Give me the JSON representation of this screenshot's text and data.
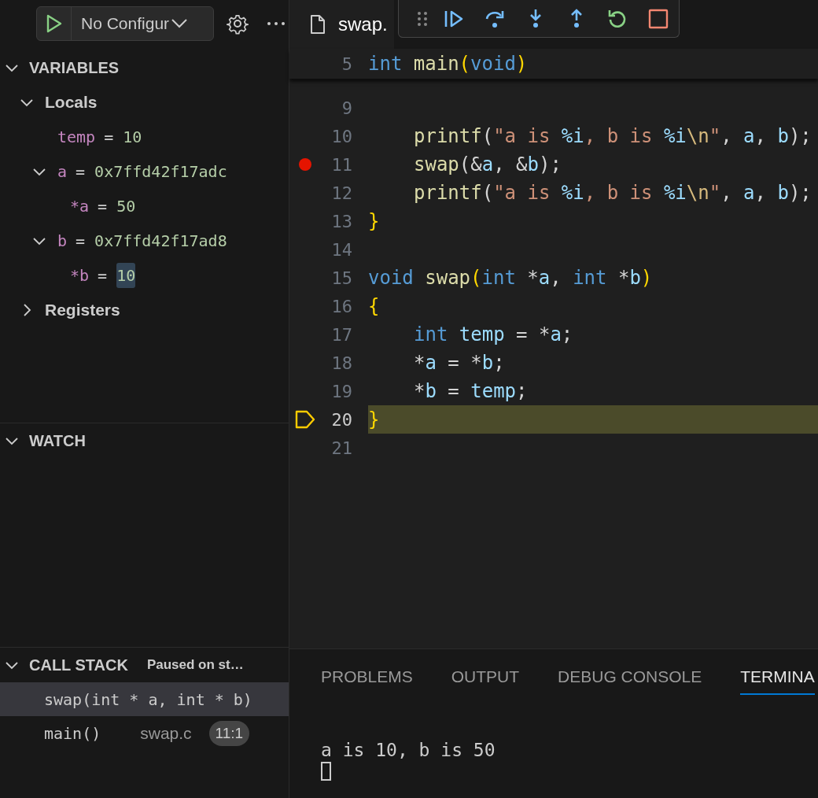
{
  "run_config": {
    "label": "No Configur"
  },
  "variables": {
    "title": "VARIABLES",
    "expanded": true,
    "items": [
      {
        "kind": "scope",
        "label": "Locals",
        "expanded": true,
        "children": [
          {
            "kind": "variable",
            "name": "temp",
            "operator": "=",
            "value": "10",
            "changed": false
          },
          {
            "kind": "variable",
            "name": "a",
            "operator": "=",
            "value": "0x7ffd42f17adc",
            "changed": false,
            "expanded": true,
            "children": [
              {
                "kind": "variable",
                "name": "*a",
                "operator": "=",
                "value": "50",
                "changed": false
              }
            ]
          },
          {
            "kind": "variable",
            "name": "b",
            "operator": "=",
            "value": "0x7ffd42f17ad8",
            "changed": false,
            "expanded": true,
            "children": [
              {
                "kind": "variable",
                "name": "*b",
                "operator": "=",
                "value": "10",
                "changed": true
              }
            ]
          }
        ]
      },
      {
        "kind": "scope",
        "label": "Registers",
        "expanded": false
      }
    ]
  },
  "watch": {
    "title": "WATCH",
    "expanded": true
  },
  "call_stack": {
    "title": "CALL STACK",
    "expanded": true,
    "status": "Paused on st…",
    "frames": [
      {
        "label": "swap(int * a, int * b)",
        "selected": true
      },
      {
        "label": "main()",
        "file": "swap.c",
        "position": "11:1",
        "selected": false
      }
    ]
  },
  "editor_tab": {
    "label": "swap."
  },
  "debug_toolbar": {
    "buttons": [
      {
        "kind": "continue"
      },
      {
        "kind": "step_over"
      },
      {
        "kind": "step_into"
      },
      {
        "kind": "step_out"
      },
      {
        "kind": "restart"
      },
      {
        "kind": "stop"
      }
    ]
  },
  "sticky_line": {
    "number": "5",
    "indented": false,
    "tokens": [
      {
        "text": "int",
        "kind": "keyword"
      },
      {
        "text": " main",
        "kind": "function"
      },
      {
        "text": "(",
        "kind": "bracket"
      },
      {
        "text": "void",
        "kind": "keyword"
      },
      {
        "text": ")",
        "kind": "bracket"
      }
    ]
  },
  "code_lines": [
    {
      "number": "9",
      "breakpoint": false,
      "current": false
    },
    {
      "number": "10",
      "breakpoint": false,
      "current": false,
      "indented": true,
      "tokens": [
        {
          "text": "printf",
          "kind": "function"
        },
        {
          "text": "(",
          "kind": "plain"
        },
        {
          "text": "\"a is ",
          "kind": "string"
        },
        {
          "text": "%i",
          "kind": "format"
        },
        {
          "text": ", b is ",
          "kind": "string"
        },
        {
          "text": "%i",
          "kind": "format"
        },
        {
          "text": "\\n",
          "kind": "escape"
        },
        {
          "text": "\"",
          "kind": "string"
        },
        {
          "text": ", ",
          "kind": "plain"
        },
        {
          "text": "a",
          "kind": "variable"
        },
        {
          "text": ", ",
          "kind": "plain"
        },
        {
          "text": "b",
          "kind": "variable"
        },
        {
          "text": ");",
          "kind": "plain"
        }
      ]
    },
    {
      "number": "11",
      "breakpoint": true,
      "current": false,
      "indented": true,
      "tokens": [
        {
          "text": "swap",
          "kind": "function"
        },
        {
          "text": "(&",
          "kind": "plain"
        },
        {
          "text": "a",
          "kind": "variable"
        },
        {
          "text": ", &",
          "kind": "plain"
        },
        {
          "text": "b",
          "kind": "variable"
        },
        {
          "text": ");",
          "kind": "plain"
        }
      ]
    },
    {
      "number": "12",
      "breakpoint": false,
      "current": false,
      "indented": true,
      "tokens": [
        {
          "text": "printf",
          "kind": "function"
        },
        {
          "text": "(",
          "kind": "plain"
        },
        {
          "text": "\"a is ",
          "kind": "string"
        },
        {
          "text": "%i",
          "kind": "format"
        },
        {
          "text": ", b is ",
          "kind": "string"
        },
        {
          "text": "%i",
          "kind": "format"
        },
        {
          "text": "\\n",
          "kind": "escape"
        },
        {
          "text": "\"",
          "kind": "string"
        },
        {
          "text": ", ",
          "kind": "plain"
        },
        {
          "text": "a",
          "kind": "variable"
        },
        {
          "text": ", ",
          "kind": "plain"
        },
        {
          "text": "b",
          "kind": "variable"
        },
        {
          "text": ");",
          "kind": "plain"
        }
      ]
    },
    {
      "number": "13",
      "breakpoint": false,
      "current": false,
      "indented": false,
      "tokens": [
        {
          "text": "}",
          "kind": "bracket"
        }
      ]
    },
    {
      "number": "14",
      "breakpoint": false,
      "current": false
    },
    {
      "number": "15",
      "breakpoint": false,
      "current": false,
      "indented": false,
      "tokens": [
        {
          "text": "void",
          "kind": "keyword"
        },
        {
          "text": " swap",
          "kind": "function"
        },
        {
          "text": "(",
          "kind": "bracket"
        },
        {
          "text": "int",
          "kind": "keyword"
        },
        {
          "text": " *",
          "kind": "plain"
        },
        {
          "text": "a",
          "kind": "variable"
        },
        {
          "text": ", ",
          "kind": "plain"
        },
        {
          "text": "int",
          "kind": "keyword"
        },
        {
          "text": " *",
          "kind": "plain"
        },
        {
          "text": "b",
          "kind": "variable"
        },
        {
          "text": ")",
          "kind": "bracket"
        }
      ]
    },
    {
      "number": "16",
      "breakpoint": false,
      "current": false,
      "indented": false,
      "tokens": [
        {
          "text": "{",
          "kind": "bracket"
        }
      ]
    },
    {
      "number": "17",
      "breakpoint": false,
      "current": false,
      "indented": true,
      "tokens": [
        {
          "text": "int",
          "kind": "keyword"
        },
        {
          "text": " temp",
          "kind": "variable"
        },
        {
          "text": " = *",
          "kind": "plain"
        },
        {
          "text": "a",
          "kind": "variable"
        },
        {
          "text": ";",
          "kind": "plain"
        }
      ]
    },
    {
      "number": "18",
      "breakpoint": false,
      "current": false,
      "indented": true,
      "tokens": [
        {
          "text": "*",
          "kind": "plain"
        },
        {
          "text": "a",
          "kind": "variable"
        },
        {
          "text": " = *",
          "kind": "plain"
        },
        {
          "text": "b",
          "kind": "variable"
        },
        {
          "text": ";",
          "kind": "plain"
        }
      ]
    },
    {
      "number": "19",
      "breakpoint": false,
      "current": false,
      "indented": true,
      "tokens": [
        {
          "text": "*",
          "kind": "plain"
        },
        {
          "text": "b",
          "kind": "variable"
        },
        {
          "text": " = ",
          "kind": "plain"
        },
        {
          "text": "temp",
          "kind": "variable"
        },
        {
          "text": ";",
          "kind": "plain"
        }
      ]
    },
    {
      "number": "20",
      "breakpoint": false,
      "current": true,
      "indented": false,
      "tokens": [
        {
          "text": "}",
          "kind": "bracket"
        }
      ]
    },
    {
      "number": "21",
      "breakpoint": false,
      "current": false
    }
  ],
  "panel_tabs": [
    {
      "label": "PROBLEMS",
      "selected": false
    },
    {
      "label": "OUTPUT",
      "selected": false
    },
    {
      "label": "DEBUG CONSOLE",
      "selected": false
    },
    {
      "label": "TERMINA",
      "selected": true
    }
  ],
  "terminal_lines": [
    "a is 10, b is 50"
  ]
}
